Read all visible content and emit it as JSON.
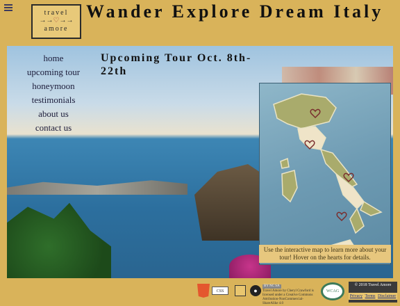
{
  "header": {
    "logo_line1": "travel",
    "logo_line2": "amore",
    "site_title": "Wander Explore Dream Italy"
  },
  "nav": {
    "items": [
      "home",
      "upcoming tour",
      "honeymoon",
      "testimonials",
      "about us",
      "contact us"
    ]
  },
  "main": {
    "tour_heading": "Upcoming Tour Oct. 8th-22th",
    "map_caption": "Use the interactive map to learn more about your tour! Hover on the hearts for details."
  },
  "footer": {
    "css_badge": "CSS",
    "cc_badge": "BY NC SA",
    "cc_text": "Travel Amore by Cheryl Crawford is licensed under a Creative Commons Attribution-NonCommercial-ShareAlike 4.0",
    "wcag_label": "WCAG",
    "copyright": "© 2018 Travel Amore",
    "links": [
      "Privacy",
      "Terms",
      "Disclaimer"
    ]
  },
  "colors": {
    "background": "#d9b35a",
    "heart": "#a23a3a",
    "map_land": "#a9ab6c"
  }
}
